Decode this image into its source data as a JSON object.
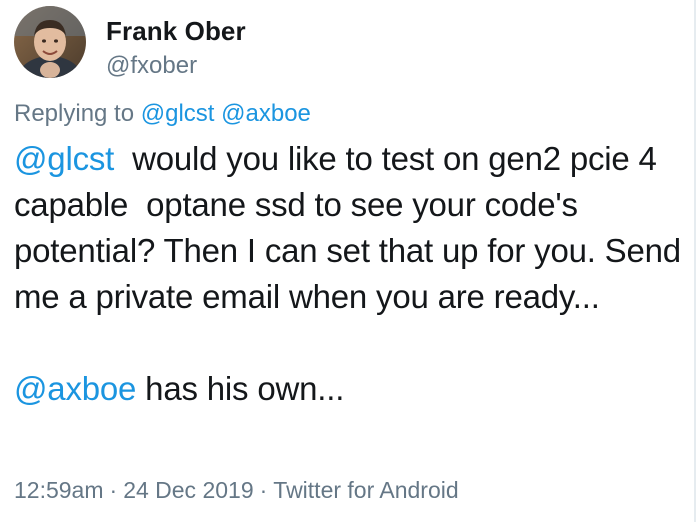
{
  "author": {
    "display_name": "Frank Ober",
    "handle": "@fxober",
    "avatar_icon": "profile-photo"
  },
  "reply_context": {
    "prefix": "Replying to ",
    "mentions": [
      "@glcst",
      "@axboe"
    ]
  },
  "tweet": {
    "paragraph1": {
      "mention": "@glcst",
      "text": "  would you like to test on gen2 pcie 4 capable  optane ssd to see your code's potential? Then I can set that up for you. Send me a private email when you are ready..."
    },
    "paragraph2": {
      "mention": "@axboe",
      "text": " has his own..."
    }
  },
  "meta": {
    "time": "12:59am",
    "separator": "·",
    "date": "24 Dec 2019",
    "source": "Twitter for Android"
  },
  "colors": {
    "link": "#1b95e0",
    "secondary_text": "#657786",
    "primary_text": "#14171a",
    "background": "#ffffff"
  }
}
